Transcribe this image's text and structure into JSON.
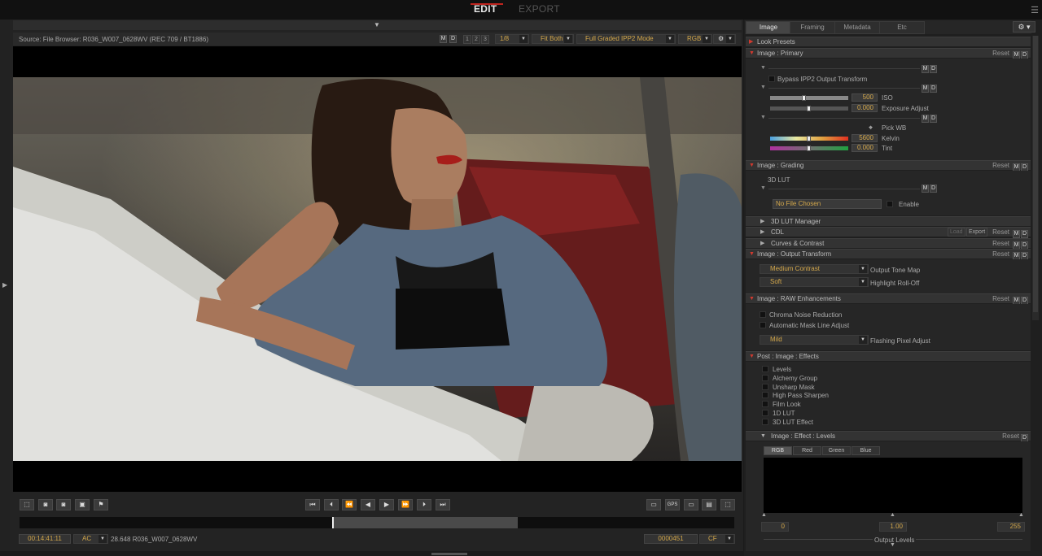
{
  "top": {
    "edit": "EDIT",
    "export": "EXPORT"
  },
  "viewer": {
    "source": "Source: File Browser: R036_W007_0628WV    (REC 709 / BT1886)",
    "m": "M",
    "d": "D",
    "views": [
      "1",
      "2",
      "3"
    ],
    "scale": "1/8",
    "fit": "Fit Both",
    "mode": "Full Graded IPP2 Mode",
    "channel": "RGB"
  },
  "bottom": {
    "timecode": "00:14:41:11",
    "ac": "AC",
    "clip": "28.648 R036_W007_0628WV",
    "frame": "0000451",
    "cf": "CF"
  },
  "timeline": {
    "playhead_fraction": 0.438,
    "range_start": 0.438,
    "range_end": 0.697
  },
  "panel": {
    "tabs": [
      "Image",
      "Framing",
      "Metadata",
      "Etc"
    ],
    "look_presets": "Look Presets",
    "primary": {
      "title": "Image : Primary",
      "reset": "Reset",
      "bypass": "Bypass IPP2 Output Transform",
      "iso": "500",
      "iso_label": "ISO",
      "exposure": "0.000",
      "exposure_label": "Exposure Adjust",
      "pick_wb": "Pick WB",
      "kelvin": "5600",
      "kelvin_label": "Kelvin",
      "tint": "0.000",
      "tint_label": "Tint"
    },
    "grading": {
      "title": "Image : Grading",
      "reset": "Reset",
      "lut_label": "3D LUT",
      "no_file": "No File Chosen",
      "enable": "Enable"
    },
    "lut_manager": "3D LUT Manager",
    "cdl": {
      "title": "CDL",
      "load": "Load",
      "export": "Export",
      "reset": "Reset"
    },
    "curves": {
      "title": "Curves & Contrast",
      "reset": "Reset"
    },
    "output": {
      "title": "Image : Output Transform",
      "reset": "Reset",
      "tone_map": "Medium Contrast",
      "tone_map_label": "Output Tone Map",
      "rolloff": "Soft",
      "rolloff_label": "Highlight Roll-Off"
    },
    "raw": {
      "title": "Image : RAW Enhancements",
      "reset": "Reset",
      "chroma": "Chroma Noise Reduction",
      "mask": "Automatic Mask Line Adjust",
      "flash": "Mild",
      "flash_label": "Flashing Pixel Adjust"
    },
    "effects": {
      "title": "Post : Image : Effects",
      "items": [
        "Levels",
        "Alchemy Group",
        "Unsharp Mask",
        "High Pass Sharpen",
        "Film Look",
        "1D LUT",
        "3D LUT Effect"
      ]
    },
    "levels": {
      "title": "Image : Effect : Levels",
      "reset": "Reset",
      "tabs": [
        "RGB",
        "Red",
        "Green",
        "Blue"
      ],
      "black": "0",
      "gamma": "1.00",
      "white": "255",
      "output": "Output Levels"
    }
  },
  "colors": {
    "accent": "#d4a84b",
    "active_tab": "#c0251f",
    "section_tri": "#d23a2f"
  }
}
